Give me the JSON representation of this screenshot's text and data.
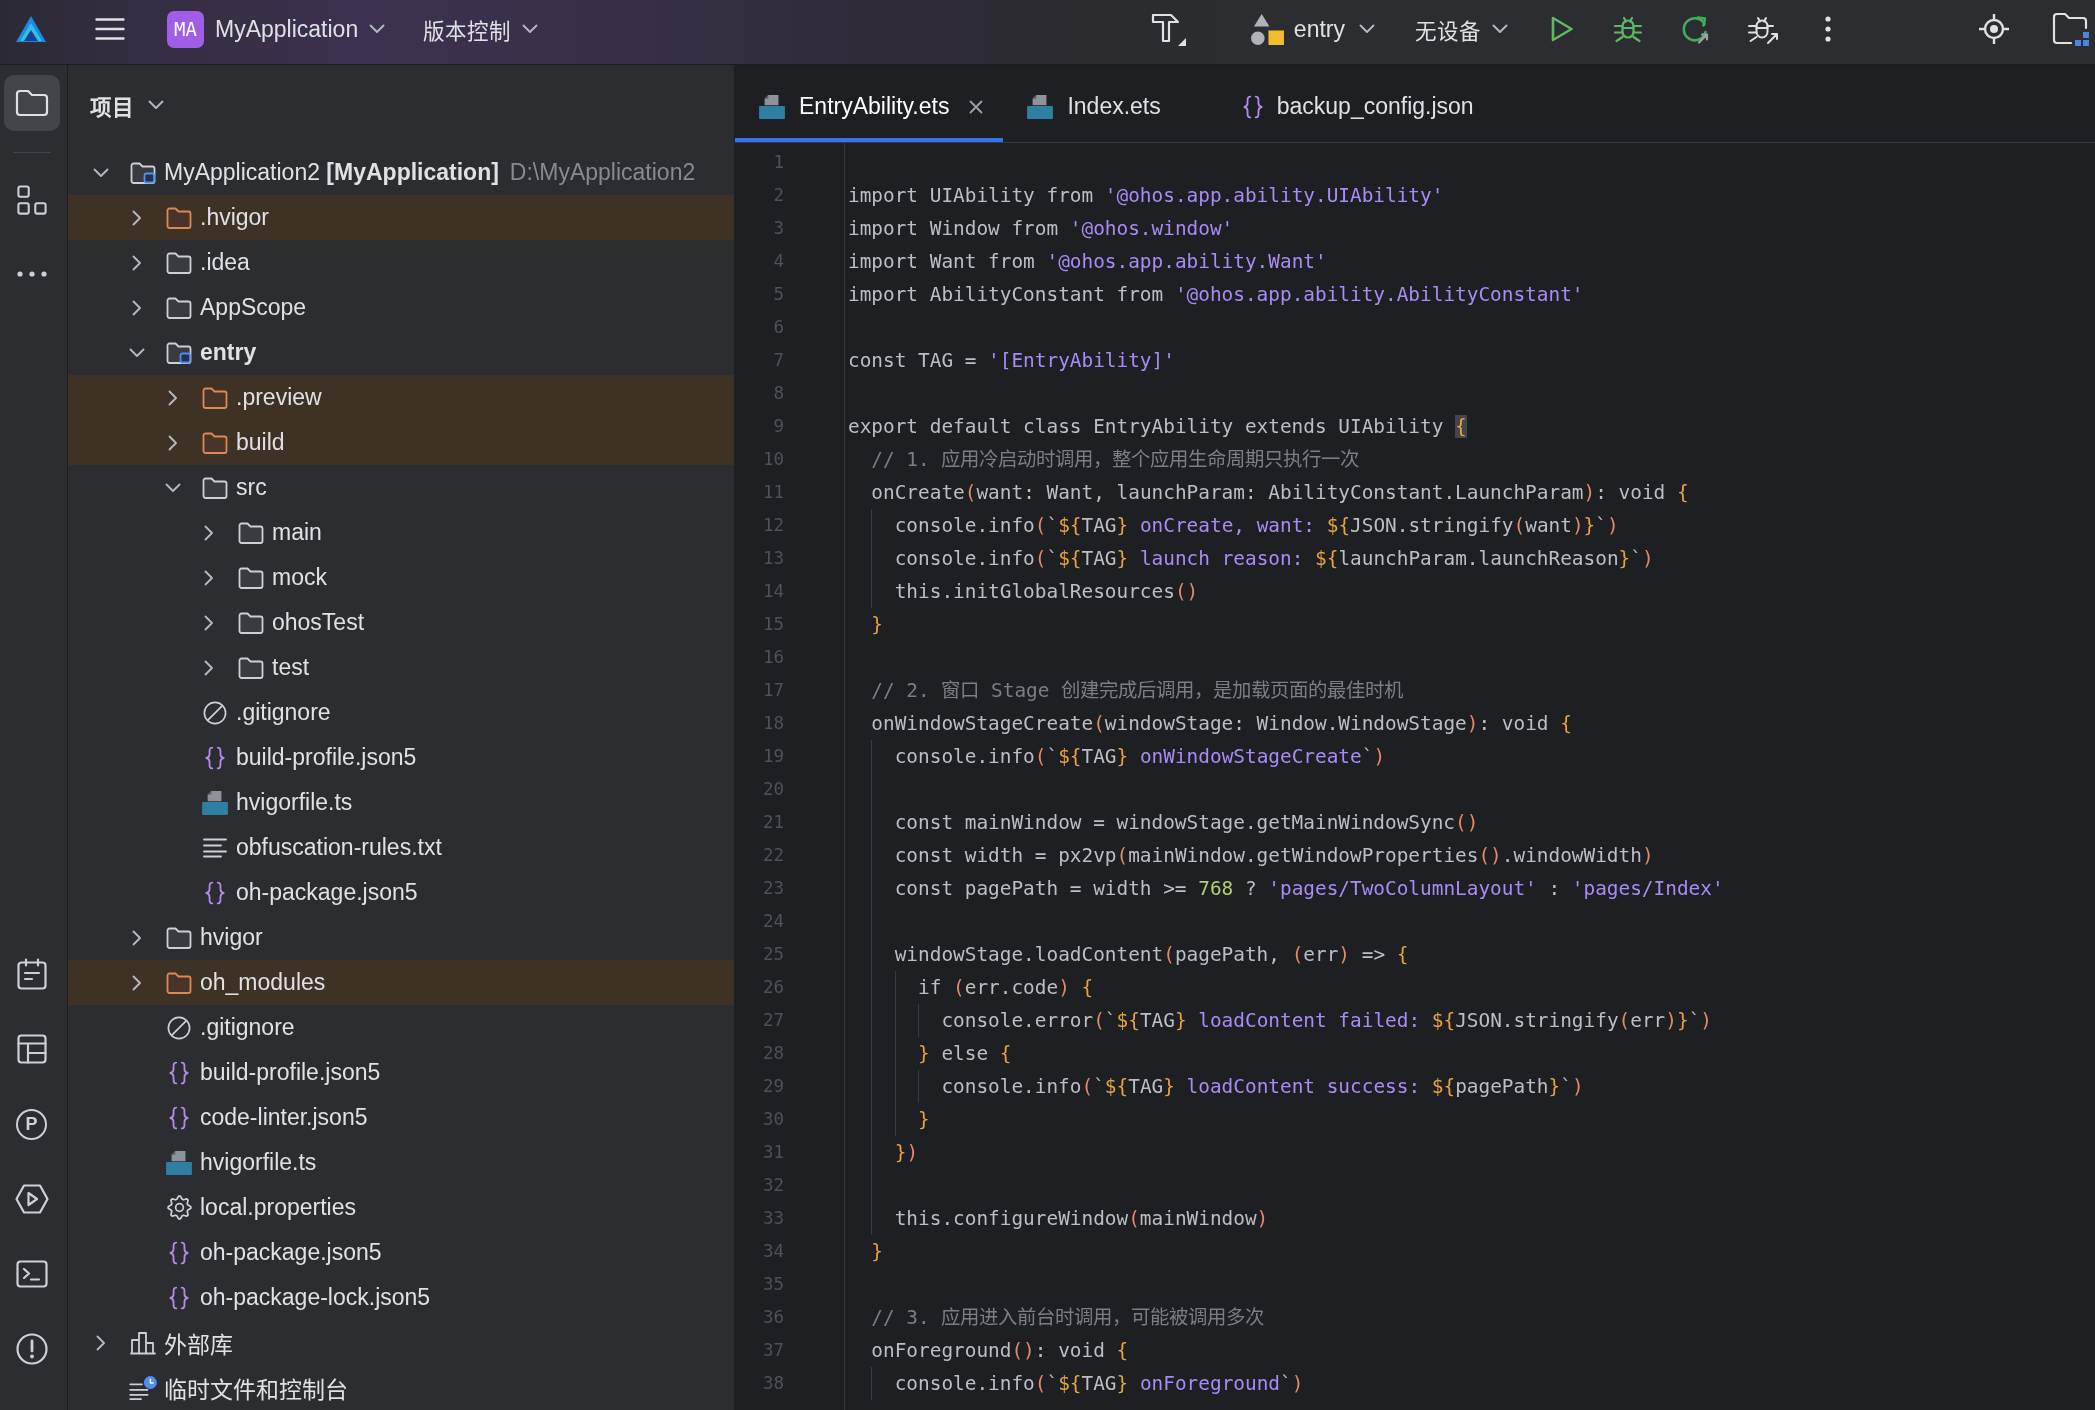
{
  "title_bar": {
    "project_badge": "MA",
    "project_name": "MyApplication",
    "vcs_menu": "版本控制",
    "run_config": "entry",
    "device": "无设备"
  },
  "tool_strip": {
    "top": [
      {
        "kind": "project",
        "selected": true
      },
      {
        "kind": "structure",
        "selected": false
      },
      {
        "kind": "more",
        "selected": false
      }
    ],
    "bottom": [
      {
        "kind": "todo",
        "selected": false
      },
      {
        "kind": "layout",
        "selected": false
      },
      {
        "kind": "profiler",
        "glyph": "P",
        "selected": false
      },
      {
        "kind": "services",
        "selected": false
      },
      {
        "kind": "terminal",
        "selected": false
      },
      {
        "kind": "problems",
        "selected": false
      }
    ]
  },
  "project_panel": {
    "title": "项目",
    "tree": [
      {
        "label": "MyApplication2 **[MyApplication]**",
        "path": "D:\\MyApplication2",
        "kind": "project",
        "expanded": true,
        "excluded": false,
        "children": [
          {
            "label": ".hvigor",
            "kind": "folder",
            "expanded": false,
            "excluded": true
          },
          {
            "label": ".idea",
            "kind": "folder",
            "expanded": false,
            "excluded": false
          },
          {
            "label": "AppScope",
            "kind": "folder",
            "expanded": false,
            "excluded": false
          },
          {
            "label": "entry",
            "kind": "module",
            "expanded": true,
            "excluded": false,
            "children": [
              {
                "label": ".preview",
                "kind": "folder",
                "expanded": false,
                "excluded": true
              },
              {
                "label": "build",
                "kind": "folder",
                "expanded": false,
                "excluded": true
              },
              {
                "label": "src",
                "kind": "folder",
                "expanded": true,
                "excluded": false,
                "children": [
                  {
                    "label": "main",
                    "kind": "folder",
                    "expanded": false,
                    "excluded": false
                  },
                  {
                    "label": "mock",
                    "kind": "folder",
                    "expanded": false,
                    "excluded": false
                  },
                  {
                    "label": "ohosTest",
                    "kind": "folder",
                    "expanded": false,
                    "excluded": false
                  },
                  {
                    "label": "test",
                    "kind": "folder",
                    "expanded": false,
                    "excluded": false
                  }
                ]
              },
              {
                "label": ".gitignore",
                "kind": "ignore",
                "excluded": false
              },
              {
                "label": "build-profile.json5",
                "kind": "json",
                "excluded": false
              },
              {
                "label": "hvigorfile.ts",
                "kind": "ts",
                "excluded": false
              },
              {
                "label": "obfuscation-rules.txt",
                "kind": "text",
                "excluded": false
              },
              {
                "label": "oh-package.json5",
                "kind": "json",
                "excluded": false
              }
            ]
          },
          {
            "label": "hvigor",
            "kind": "folder",
            "expanded": false,
            "excluded": false
          },
          {
            "label": "oh_modules",
            "kind": "folder",
            "expanded": false,
            "excluded": true
          },
          {
            "label": ".gitignore",
            "kind": "ignore",
            "excluded": false
          },
          {
            "label": "build-profile.json5",
            "kind": "json",
            "excluded": false
          },
          {
            "label": "code-linter.json5",
            "kind": "json",
            "excluded": false
          },
          {
            "label": "hvigorfile.ts",
            "kind": "ts",
            "excluded": false
          },
          {
            "label": "local.properties",
            "kind": "settings",
            "excluded": false
          },
          {
            "label": "oh-package.json5",
            "kind": "json",
            "excluded": false
          },
          {
            "label": "oh-package-lock.json5",
            "kind": "json",
            "excluded": false
          }
        ]
      },
      {
        "label": "外部库",
        "kind": "library",
        "expanded": false,
        "excluded": false
      },
      {
        "label": "临时文件和控制台",
        "kind": "scratches",
        "excluded": false
      }
    ]
  },
  "editor": {
    "tabs": [
      {
        "label": "EntryAbility.ets",
        "kind": "ets",
        "selected": true
      },
      {
        "label": "Index.ets",
        "kind": "ets",
        "selected": false
      },
      {
        "label": "backup_config.json",
        "kind": "json",
        "selected": false
      }
    ],
    "lines": [
      {
        "number": "1"
      },
      {
        "number": "2",
        "tokens": [
          {
            "kind": "plain",
            "text": "import UIAbility from "
          },
          {
            "kind": "string",
            "text": "'@ohos.app.ability.UIAbility'"
          }
        ]
      },
      {
        "number": "3",
        "tokens": [
          {
            "kind": "plain",
            "text": "import Window from "
          },
          {
            "kind": "string",
            "text": "'@ohos.window'"
          }
        ]
      },
      {
        "number": "4",
        "tokens": [
          {
            "kind": "plain",
            "text": "import Want from "
          },
          {
            "kind": "string",
            "text": "'@ohos.app.ability.Want'"
          }
        ]
      },
      {
        "number": "5",
        "tokens": [
          {
            "kind": "plain",
            "text": "import AbilityConstant from "
          },
          {
            "kind": "string",
            "text": "'@ohos.app.ability.AbilityConstant'"
          }
        ]
      },
      {
        "number": "6"
      },
      {
        "number": "7",
        "tokens": [
          {
            "kind": "plain",
            "text": "const TAG = "
          },
          {
            "kind": "string",
            "text": "'[EntryAbility]'"
          }
        ]
      },
      {
        "number": "8"
      },
      {
        "number": "9",
        "tokens": [
          {
            "kind": "plain",
            "text": "export default class EntryAbility extends UIAbility "
          },
          {
            "kind": "match",
            "text": "{"
          }
        ]
      },
      {
        "number": "10",
        "tokens": [
          {
            "kind": "comment",
            "text": "  // 1. 应用冷启动时调用，整个应用生命周期只执行一次"
          }
        ]
      },
      {
        "number": "11",
        "tokens": [
          {
            "kind": "plain",
            "text": "  onCreate"
          },
          {
            "kind": "paren",
            "text": "("
          },
          {
            "kind": "plain",
            "text": "want: Want, launchParam: AbilityConstant.LaunchParam"
          },
          {
            "kind": "paren",
            "text": ")"
          },
          {
            "kind": "plain",
            "text": ": void "
          },
          {
            "kind": "brace",
            "text": "{"
          }
        ]
      },
      {
        "number": "12",
        "tokens": [
          {
            "kind": "plain",
            "text": "    console.info"
          },
          {
            "kind": "paren",
            "text": "("
          },
          {
            "kind": "plain",
            "text": "`"
          },
          {
            "kind": "brace",
            "text": "${"
          },
          {
            "kind": "plain",
            "text": "TAG"
          },
          {
            "kind": "brace",
            "text": "}"
          },
          {
            "kind": "string",
            "text": " onCreate, want: "
          },
          {
            "kind": "brace",
            "text": "${"
          },
          {
            "kind": "plain",
            "text": "JSON.stringify"
          },
          {
            "kind": "paren",
            "text": "("
          },
          {
            "kind": "plain",
            "text": "want"
          },
          {
            "kind": "paren",
            "text": ")"
          },
          {
            "kind": "brace",
            "text": "}"
          },
          {
            "kind": "plain",
            "text": "`"
          },
          {
            "kind": "paren",
            "text": ")"
          }
        ]
      },
      {
        "number": "13",
        "tokens": [
          {
            "kind": "plain",
            "text": "    console.info"
          },
          {
            "kind": "paren",
            "text": "("
          },
          {
            "kind": "plain",
            "text": "`"
          },
          {
            "kind": "brace",
            "text": "${"
          },
          {
            "kind": "plain",
            "text": "TAG"
          },
          {
            "kind": "brace",
            "text": "}"
          },
          {
            "kind": "string",
            "text": " launch reason: "
          },
          {
            "kind": "brace",
            "text": "${"
          },
          {
            "kind": "plain",
            "text": "launchParam.launchReason"
          },
          {
            "kind": "brace",
            "text": "}"
          },
          {
            "kind": "plain",
            "text": "`"
          },
          {
            "kind": "paren",
            "text": ")"
          }
        ]
      },
      {
        "number": "14",
        "tokens": [
          {
            "kind": "plain",
            "text": "    this.initGlobalResources"
          },
          {
            "kind": "paren",
            "text": "()"
          }
        ]
      },
      {
        "number": "15",
        "tokens": [
          {
            "kind": "brace",
            "text": "  }"
          }
        ]
      },
      {
        "number": "16"
      },
      {
        "number": "17",
        "tokens": [
          {
            "kind": "comment",
            "text": "  // 2. 窗口 Stage 创建完成后调用，是加载页面的最佳时机"
          }
        ]
      },
      {
        "number": "18",
        "tokens": [
          {
            "kind": "plain",
            "text": "  onWindowStageCreate"
          },
          {
            "kind": "paren",
            "text": "("
          },
          {
            "kind": "plain",
            "text": "windowStage: Window.WindowStage"
          },
          {
            "kind": "paren",
            "text": ")"
          },
          {
            "kind": "plain",
            "text": ": void "
          },
          {
            "kind": "brace",
            "text": "{"
          }
        ]
      },
      {
        "number": "19",
        "tokens": [
          {
            "kind": "plain",
            "text": "    console.info"
          },
          {
            "kind": "paren",
            "text": "("
          },
          {
            "kind": "plain",
            "text": "`"
          },
          {
            "kind": "brace",
            "text": "${"
          },
          {
            "kind": "plain",
            "text": "TAG"
          },
          {
            "kind": "brace",
            "text": "}"
          },
          {
            "kind": "string",
            "text": " onWindowStageCreate"
          },
          {
            "kind": "plain",
            "text": "`"
          },
          {
            "kind": "paren",
            "text": ")"
          }
        ]
      },
      {
        "number": "20"
      },
      {
        "number": "21",
        "tokens": [
          {
            "kind": "plain",
            "text": "    const mainWindow = windowStage.getMainWindowSync"
          },
          {
            "kind": "paren",
            "text": "()"
          }
        ]
      },
      {
        "number": "22",
        "tokens": [
          {
            "kind": "plain",
            "text": "    const width = px2vp"
          },
          {
            "kind": "paren",
            "text": "("
          },
          {
            "kind": "plain",
            "text": "mainWindow.getWindowProperties"
          },
          {
            "kind": "paren",
            "text": "()"
          },
          {
            "kind": "plain",
            "text": ".windowWidth"
          },
          {
            "kind": "paren",
            "text": ")"
          }
        ]
      },
      {
        "number": "23",
        "tokens": [
          {
            "kind": "plain",
            "text": "    const pagePath = width >= "
          },
          {
            "kind": "number",
            "text": "768"
          },
          {
            "kind": "plain",
            "text": " ? "
          },
          {
            "kind": "string",
            "text": "'pages/TwoColumnLayout'"
          },
          {
            "kind": "plain",
            "text": " : "
          },
          {
            "kind": "string",
            "text": "'pages/Index'"
          }
        ]
      },
      {
        "number": "24"
      },
      {
        "number": "25",
        "tokens": [
          {
            "kind": "plain",
            "text": "    windowStage.loadContent"
          },
          {
            "kind": "paren",
            "text": "("
          },
          {
            "kind": "plain",
            "text": "pagePath, "
          },
          {
            "kind": "paren",
            "text": "("
          },
          {
            "kind": "plain",
            "text": "err"
          },
          {
            "kind": "paren",
            "text": ")"
          },
          {
            "kind": "plain",
            "text": " => "
          },
          {
            "kind": "brace",
            "text": "{"
          }
        ]
      },
      {
        "number": "26",
        "tokens": [
          {
            "kind": "plain",
            "text": "      if "
          },
          {
            "kind": "paren",
            "text": "("
          },
          {
            "kind": "plain",
            "text": "err.code"
          },
          {
            "kind": "paren",
            "text": ")"
          },
          {
            "kind": "brace",
            "text": " {"
          }
        ]
      },
      {
        "number": "27",
        "tokens": [
          {
            "kind": "plain",
            "text": "        console.error"
          },
          {
            "kind": "paren",
            "text": "("
          },
          {
            "kind": "plain",
            "text": "`"
          },
          {
            "kind": "brace",
            "text": "${"
          },
          {
            "kind": "plain",
            "text": "TAG"
          },
          {
            "kind": "brace",
            "text": "}"
          },
          {
            "kind": "string",
            "text": " loadContent failed: "
          },
          {
            "kind": "brace",
            "text": "${"
          },
          {
            "kind": "plain",
            "text": "JSON.stringify"
          },
          {
            "kind": "paren",
            "text": "("
          },
          {
            "kind": "plain",
            "text": "err"
          },
          {
            "kind": "paren",
            "text": ")"
          },
          {
            "kind": "brace",
            "text": "}"
          },
          {
            "kind": "plain",
            "text": "`"
          },
          {
            "kind": "paren",
            "text": ")"
          }
        ]
      },
      {
        "number": "28",
        "tokens": [
          {
            "kind": "brace",
            "text": "      }"
          },
          {
            "kind": "plain",
            "text": " else "
          },
          {
            "kind": "brace",
            "text": "{"
          }
        ]
      },
      {
        "number": "29",
        "tokens": [
          {
            "kind": "plain",
            "text": "        console.info"
          },
          {
            "kind": "paren",
            "text": "("
          },
          {
            "kind": "plain",
            "text": "`"
          },
          {
            "kind": "brace",
            "text": "${"
          },
          {
            "kind": "plain",
            "text": "TAG"
          },
          {
            "kind": "brace",
            "text": "}"
          },
          {
            "kind": "string",
            "text": " loadContent success: "
          },
          {
            "kind": "brace",
            "text": "${"
          },
          {
            "kind": "plain",
            "text": "pagePath"
          },
          {
            "kind": "brace",
            "text": "}"
          },
          {
            "kind": "plain",
            "text": "`"
          },
          {
            "kind": "paren",
            "text": ")"
          }
        ]
      },
      {
        "number": "30",
        "tokens": [
          {
            "kind": "brace",
            "text": "      }"
          }
        ]
      },
      {
        "number": "31",
        "tokens": [
          {
            "kind": "brace",
            "text": "    }"
          },
          {
            "kind": "paren",
            "text": ")"
          }
        ]
      },
      {
        "number": "32"
      },
      {
        "number": "33",
        "tokens": [
          {
            "kind": "plain",
            "text": "    this.configureWindow"
          },
          {
            "kind": "paren",
            "text": "("
          },
          {
            "kind": "plain",
            "text": "mainWindow"
          },
          {
            "kind": "paren",
            "text": ")"
          }
        ]
      },
      {
        "number": "34",
        "tokens": [
          {
            "kind": "brace",
            "text": "  }"
          }
        ]
      },
      {
        "number": "35"
      },
      {
        "number": "36",
        "tokens": [
          {
            "kind": "comment",
            "text": "  // 3. 应用进入前台时调用，可能被调用多次"
          }
        ]
      },
      {
        "number": "37",
        "tokens": [
          {
            "kind": "plain",
            "text": "  onForeground"
          },
          {
            "kind": "paren",
            "text": "()"
          },
          {
            "kind": "plain",
            "text": ": void "
          },
          {
            "kind": "brace",
            "text": "{"
          }
        ]
      },
      {
        "number": "38",
        "tokens": [
          {
            "kind": "plain",
            "text": "    console.info"
          },
          {
            "kind": "paren",
            "text": "("
          },
          {
            "kind": "plain",
            "text": "`"
          },
          {
            "kind": "brace",
            "text": "${"
          },
          {
            "kind": "plain",
            "text": "TAG"
          },
          {
            "kind": "brace",
            "text": "}"
          },
          {
            "kind": "string",
            "text": " onForeground"
          },
          {
            "kind": "plain",
            "text": "`"
          },
          {
            "kind": "paren",
            "text": ")"
          }
        ]
      }
    ]
  }
}
